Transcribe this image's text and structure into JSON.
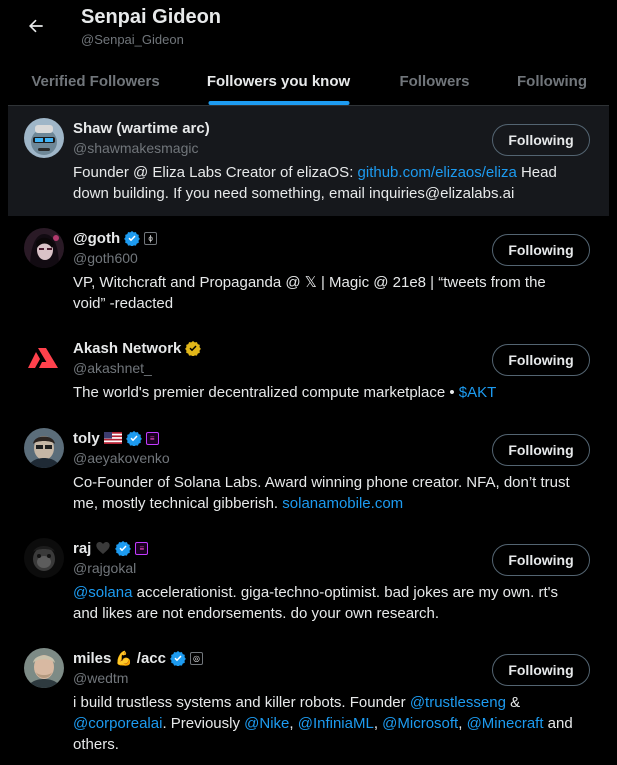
{
  "header": {
    "title": "Senpai Gideon",
    "handle": "@Senpai_Gideon"
  },
  "tabs": [
    {
      "label": "Verified Followers"
    },
    {
      "label": "Followers you know"
    },
    {
      "label": "Followers"
    },
    {
      "label": "Following"
    }
  ],
  "follow_label": "Following",
  "users": [
    {
      "name": "Shaw (wartime arc)",
      "handle": "@shawmakesmagic",
      "bio": [
        {
          "t": "Founder @ Eliza Labs Creator of elizaOS: ",
          "link": false
        },
        {
          "t": "github.com/elizaos/eliza",
          "link": true
        },
        {
          "t": " Head down building. If you need something, email inquiries@elizalabs.ai",
          "link": false
        }
      ]
    },
    {
      "name": "@goth",
      "handle": "@goth600",
      "bio": [
        {
          "t": "VP, Witchcraft and Propaganda @ 𝕏 | Magic @ 21e8 | “tweets from the void” -redacted",
          "link": false
        }
      ]
    },
    {
      "name": "Akash Network",
      "handle": "@akashnet_",
      "bio": [
        {
          "t": "The world's premier decentralized compute marketplace • ",
          "link": false
        },
        {
          "t": "$AKT",
          "link": true
        }
      ]
    },
    {
      "name": "toly",
      "handle": "@aeyakovenko",
      "bio": [
        {
          "t": "Co-Founder of Solana Labs. Award winning phone creator. NFA, don’t trust me, mostly technical gibberish. ",
          "link": false
        },
        {
          "t": "solanamobile.com",
          "link": true
        }
      ]
    },
    {
      "name": "raj",
      "handle": "@rajgokal",
      "bio": [
        {
          "t": "@solana",
          "link": true
        },
        {
          "t": " accelerationist. giga-techno-optimist. bad jokes are my own. rt's and likes are not endorsements. do your own research.",
          "link": false
        }
      ]
    },
    {
      "name": "miles",
      "name_suffix": "/acc",
      "handle": "@wedtm",
      "bio": [
        {
          "t": "i build trustless systems and killer robots. Founder ",
          "link": false
        },
        {
          "t": "@trustlesseng",
          "link": true
        },
        {
          "t": " & ",
          "link": false
        },
        {
          "t": "@corporealai",
          "link": true
        },
        {
          "t": ". Previously ",
          "link": false
        },
        {
          "t": "@Nike",
          "link": true
        },
        {
          "t": ", ",
          "link": false
        },
        {
          "t": "@InfiniaML",
          "link": true
        },
        {
          "t": ", ",
          "link": false
        },
        {
          "t": "@Microsoft",
          "link": true
        },
        {
          "t": ", ",
          "link": false
        },
        {
          "t": "@Minecraft",
          "link": true
        },
        {
          "t": " and others.",
          "link": false
        }
      ]
    }
  ],
  "colors": {
    "background": "#000000",
    "accent": "#1d9bf0",
    "gold_badge": "#e2b719",
    "text_primary": "#e7e9ea",
    "text_secondary": "#71767b"
  },
  "icons": [
    "back-arrow-icon",
    "verified-blue-icon",
    "verified-gold-icon",
    "affiliate-icon",
    "us-flag-icon",
    "black-heart-icon",
    "flexed-biceps-icon"
  ]
}
